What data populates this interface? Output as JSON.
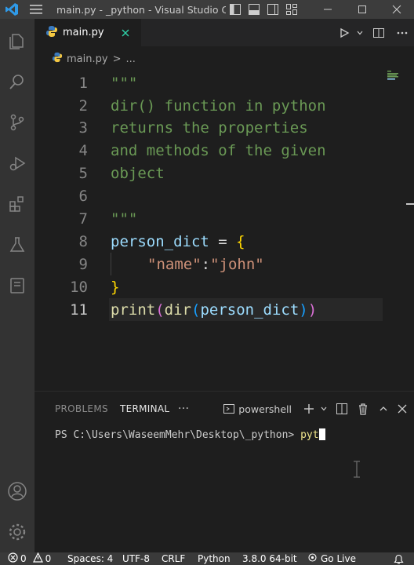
{
  "titlebar": {
    "title": "main.py - _python - Visual Studio C..."
  },
  "tab": {
    "filename": "main.py"
  },
  "breadcrumb": {
    "file": "main.py",
    "separator": ">",
    "more": "..."
  },
  "editor": {
    "lines": [
      {
        "num": "1",
        "text": "\"\"\""
      },
      {
        "num": "2",
        "text": "dir() function in python"
      },
      {
        "num": "3",
        "text": "returns the properties"
      },
      {
        "num": "4",
        "text": "and methods of the given"
      },
      {
        "num": "5",
        "text": "object"
      },
      {
        "num": "6",
        "text": ""
      },
      {
        "num": "7",
        "text": "\"\"\""
      },
      {
        "num": "8",
        "var": "person_dict",
        "op": " = ",
        "brace": "{"
      },
      {
        "num": "9",
        "key": "\"name\"",
        "colon": ":",
        "value": "\"john\""
      },
      {
        "num": "10",
        "brace": "}"
      },
      {
        "num": "11",
        "fn_print": "print",
        "p1": "(",
        "fn_dir": "dir",
        "p2": "(",
        "var": "person_dict",
        "p2c": ")",
        "p1c": ")"
      }
    ],
    "active_line": "11"
  },
  "panel": {
    "tabs": [
      "PROBLEMS",
      "TERMINAL"
    ],
    "active_tab": "TERMINAL",
    "more": "···",
    "shell": "powershell",
    "prompt": "PS C:\\Users\\WaseemMehr\\Desktop\\_python> ",
    "command": "pyt"
  },
  "statusbar": {
    "errors": "0",
    "warnings": "0",
    "spaces": "Spaces: 4",
    "encoding": "UTF-8",
    "eol": "CRLF",
    "language": "Python",
    "interpreter": "3.8.0 64-bit",
    "golive": "Go Live"
  },
  "colors": {
    "accent": "#007acc",
    "comment": "#6a9955",
    "variable": "#9cdcfe",
    "string": "#ce9178",
    "function": "#dcdcaa",
    "brace": "#ffd700"
  },
  "icons": {
    "activity": [
      "files-icon",
      "search-icon",
      "source-control-icon",
      "run-debug-icon",
      "extensions-icon",
      "testing-icon",
      "remote-explorer-icon",
      "account-icon",
      "settings-gear-icon"
    ]
  }
}
